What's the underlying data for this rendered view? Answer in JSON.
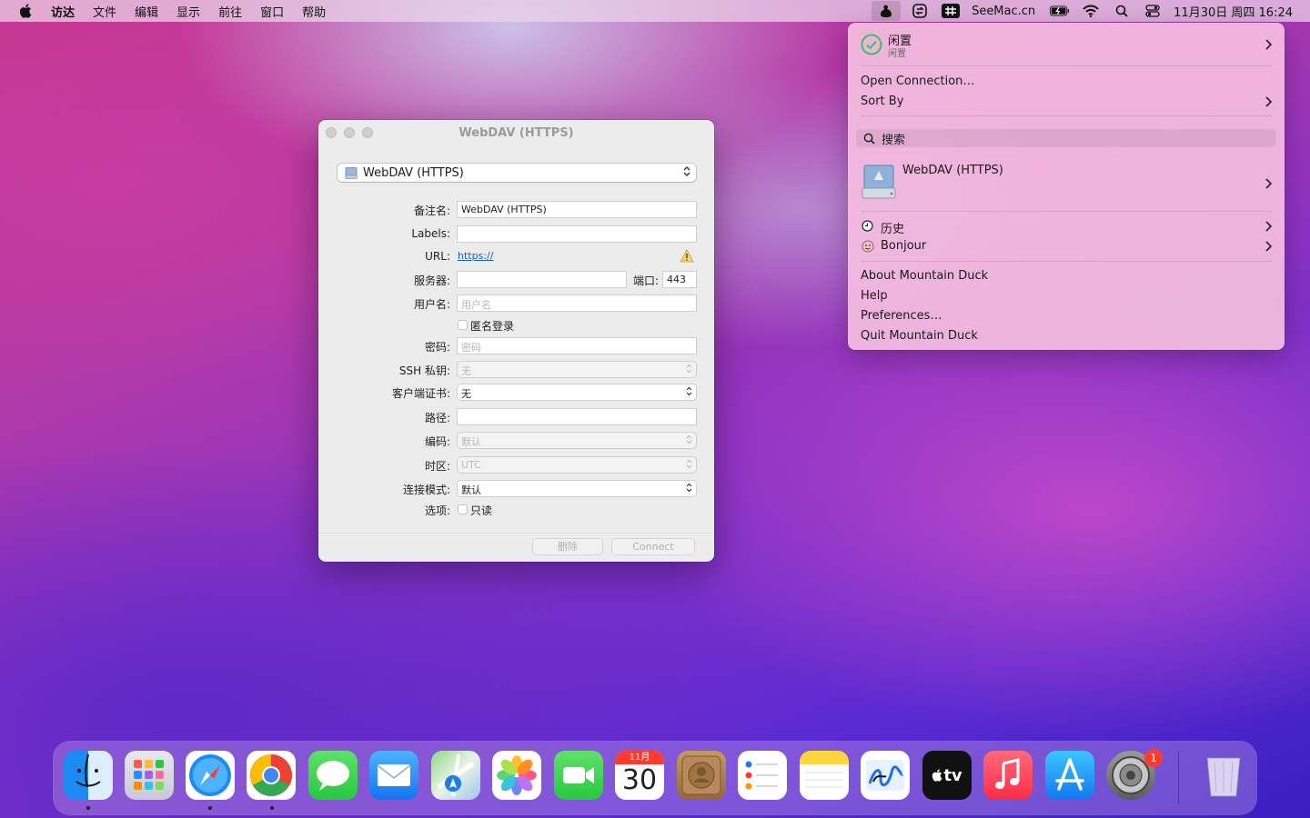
{
  "menubar": {
    "app_name": "访达",
    "items": [
      "文件",
      "编辑",
      "显示",
      "前往",
      "窗口",
      "帮助"
    ],
    "site": "SeeMac.cn",
    "datetime": "11月30日 周四  16:24"
  },
  "window": {
    "title": "WebDAV (HTTPS)",
    "protocol": "WebDAV (HTTPS)",
    "fields": {
      "nickname_label": "备注名:",
      "nickname_value": "WebDAV (HTTPS)",
      "labels_label": "Labels:",
      "url_label": "URL:",
      "url_value": "https://",
      "server_label": "服务器:",
      "port_label": "端口:",
      "port_value": "443",
      "username_label": "用户名:",
      "username_placeholder": "用户名",
      "anonymous_label": "匿名登录",
      "password_label": "密码:",
      "password_placeholder": "密码",
      "ssh_key_label": "SSH 私钥:",
      "ssh_key_value": "无",
      "client_cert_label": "客户端证书:",
      "client_cert_value": "无",
      "path_label": "路径:",
      "encoding_label": "编码:",
      "encoding_value": "默认",
      "timezone_label": "时区:",
      "timezone_value": "UTC",
      "connect_mode_label": "连接模式:",
      "connect_mode_value": "默认",
      "options_label": "选项:",
      "readonly_label": "只读"
    },
    "buttons": {
      "delete": "删除",
      "connect": "Connect"
    }
  },
  "dropdown": {
    "status_title": "闲置",
    "status_subtitle": "闲置",
    "open_connection": "Open Connection…",
    "sort_by": "Sort By",
    "search_placeholder": "搜索",
    "bookmark": "WebDAV (HTTPS)",
    "history": "历史",
    "bonjour": "Bonjour",
    "about": "About Mountain Duck",
    "help": "Help",
    "preferences": "Preferences…",
    "quit": "Quit Mountain Duck"
  },
  "dock": {
    "apps": [
      "finder-icon",
      "launchpad-icon",
      "safari-icon",
      "chrome-icon",
      "messages-icon",
      "mail-icon",
      "maps-icon",
      "photos-icon",
      "facetime-icon",
      "calendar-icon",
      "contacts-icon",
      "reminders-icon",
      "notes-icon",
      "freeform-icon",
      "tv-icon",
      "music-icon",
      "app-store-icon",
      "system-settings-icon",
      "trash-icon"
    ],
    "calendar_month": "11月",
    "calendar_day": "30",
    "tv_label": "tv",
    "settings_badge": "1"
  }
}
